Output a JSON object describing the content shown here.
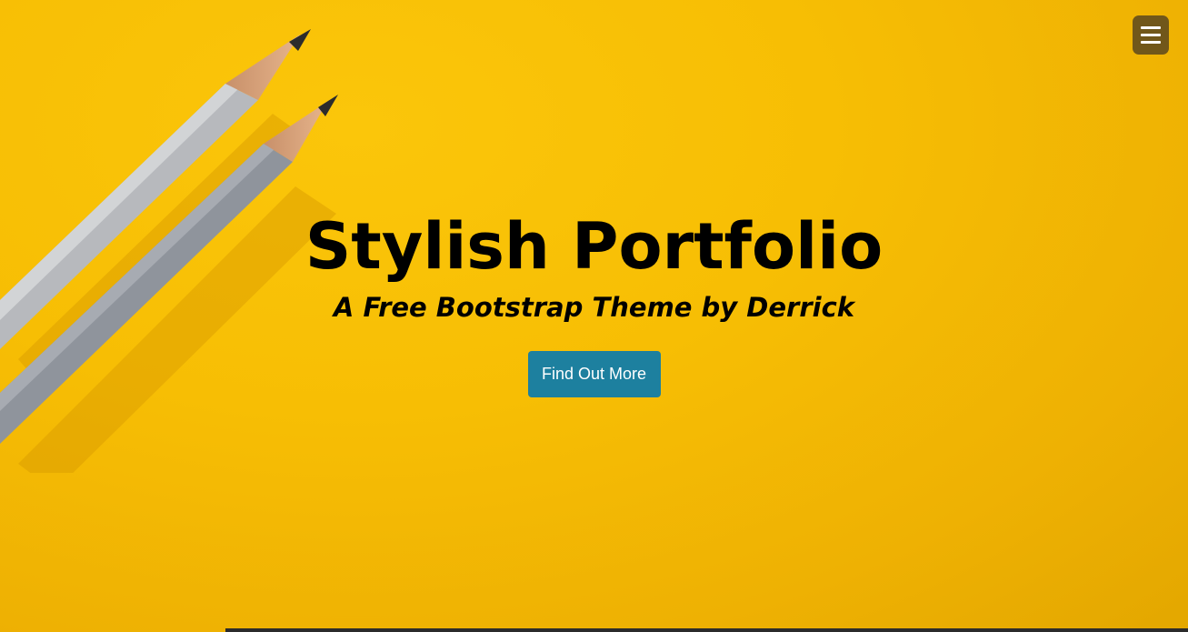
{
  "hero": {
    "title": "Stylish Portfolio",
    "subtitle": "A Free Bootstrap Theme by Derrick",
    "cta_label": "Find Out More",
    "background_color": "#f5bd05"
  },
  "nav": {
    "menu_icon": "hamburger-menu-icon"
  },
  "colors": {
    "accent": "#1d809f",
    "text": "#000000"
  }
}
